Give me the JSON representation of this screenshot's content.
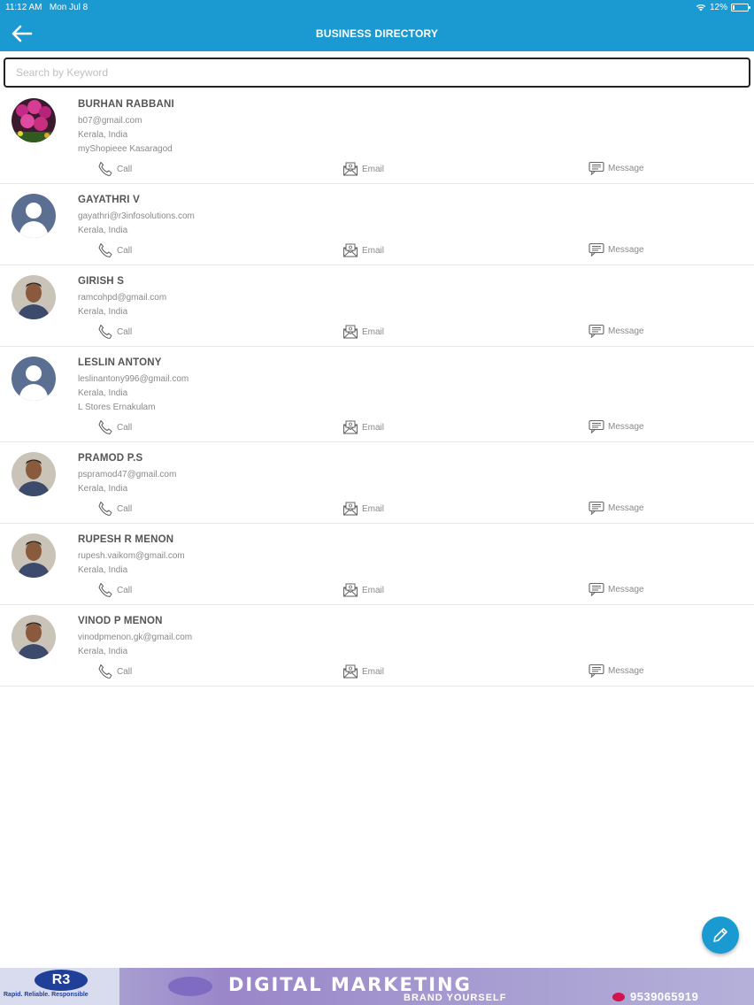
{
  "status_bar": {
    "time": "11:12 AM",
    "date": "Mon Jul 8",
    "battery": "12%",
    "battery_level": 0.12
  },
  "header": {
    "title": "BUSINESS DIRECTORY",
    "back_icon": "arrow-left-icon"
  },
  "search": {
    "placeholder": "Search by Keyword",
    "value": ""
  },
  "action_labels": {
    "call": "Call",
    "email": "Email",
    "message": "Message"
  },
  "contacts": [
    {
      "name": "BURHAN RABBANI",
      "email": "b07@gmail.com",
      "location": "Kerala, India",
      "business": "myShopieee Kasaragod",
      "avatar": "flowers-photo"
    },
    {
      "name": "GAYATHRI V",
      "email": "gayathri@r3infosolutions.com",
      "location": "Kerala, India",
      "business": "",
      "avatar": "placeholder"
    },
    {
      "name": "GIRISH S",
      "email": "ramcohpd@gmail.com",
      "location": "Kerala, India",
      "business": "",
      "avatar": "person-photo"
    },
    {
      "name": "LESLIN ANTONY",
      "email": "leslinantony996@gmail.com",
      "location": "Kerala, India",
      "business": "L Stores Ernakulam",
      "avatar": "placeholder"
    },
    {
      "name": "PRAMOD P.S",
      "email": "pspramod47@gmail.com",
      "location": "Kerala, India",
      "business": "",
      "avatar": "person-photo"
    },
    {
      "name": "RUPESH R MENON",
      "email": "rupesh.vaikom@gmail.com",
      "location": "Kerala, India",
      "business": "",
      "avatar": "person-photo"
    },
    {
      "name": "VINOD P MENON",
      "email": "vinodpmenon.gk@gmail.com",
      "location": "Kerala, India",
      "business": "",
      "avatar": "person-photo"
    }
  ],
  "fab": {
    "icon": "pencil-icon"
  },
  "banner": {
    "logo_text": "R3",
    "logo_subtitle": "Rapid. Reliable. Responsible",
    "headline": "DIGITAL MARKETING",
    "tagline": "BRAND YOURSELF",
    "phone": "9539065919"
  },
  "colors": {
    "primary": "#1a9ad0",
    "text_name": "#555555",
    "text_secondary": "#8a8a8a"
  }
}
